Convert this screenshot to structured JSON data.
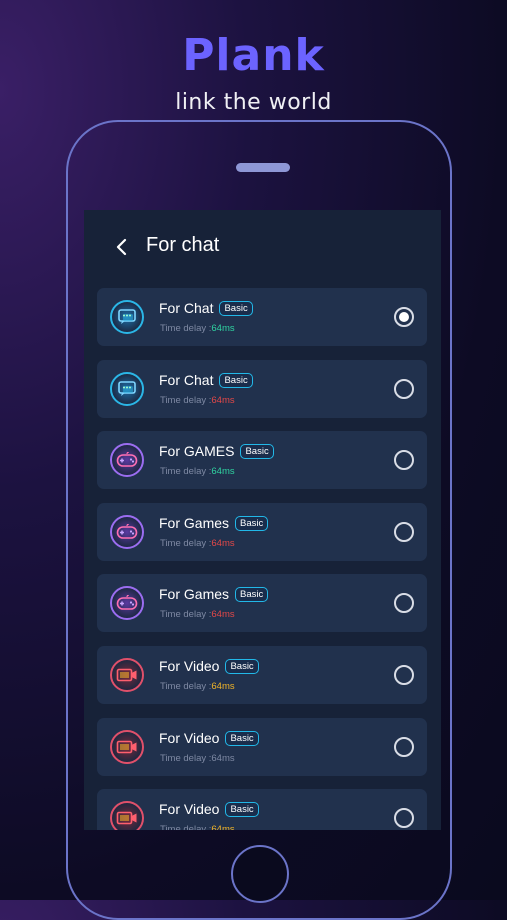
{
  "app": {
    "name": "Plank",
    "tagline": "link the world",
    "brand_color": "#6c63ff"
  },
  "screen": {
    "title": "For chat",
    "back_icon": "chevron-left-icon"
  },
  "delay_label": "Time delay :",
  "items": [
    {
      "name": "For Chat",
      "badge": "Basic",
      "delay_value": "64ms",
      "delay_color": "#2fd3a1",
      "icon": "chat-icon",
      "selected": true
    },
    {
      "name": "For Chat",
      "badge": "Basic",
      "delay_value": "64ms",
      "delay_color": "#e34848",
      "icon": "chat-icon",
      "selected": false
    },
    {
      "name": "For GAMES",
      "badge": "Basic",
      "delay_value": "64ms",
      "delay_color": "#2fd3a1",
      "icon": "gamepad-icon",
      "selected": false
    },
    {
      "name": "For Games",
      "badge": "Basic",
      "delay_value": "64ms",
      "delay_color": "#e34848",
      "icon": "gamepad-icon",
      "selected": false
    },
    {
      "name": "For Games",
      "badge": "Basic",
      "delay_value": "64ms",
      "delay_color": "#e34848",
      "icon": "gamepad-icon",
      "selected": false
    },
    {
      "name": "For Video",
      "badge": "Basic",
      "delay_value": "64ms",
      "delay_color": "#f0b429",
      "icon": "video-icon",
      "selected": false
    },
    {
      "name": "For Video",
      "badge": "Basic",
      "delay_value": "64ms",
      "delay_color": "#7e89a3",
      "icon": "video-icon",
      "selected": false
    },
    {
      "name": "For Video",
      "badge": "Basic",
      "delay_value": "64ms",
      "delay_color": "#f0b429",
      "icon": "video-icon",
      "selected": false
    }
  ]
}
